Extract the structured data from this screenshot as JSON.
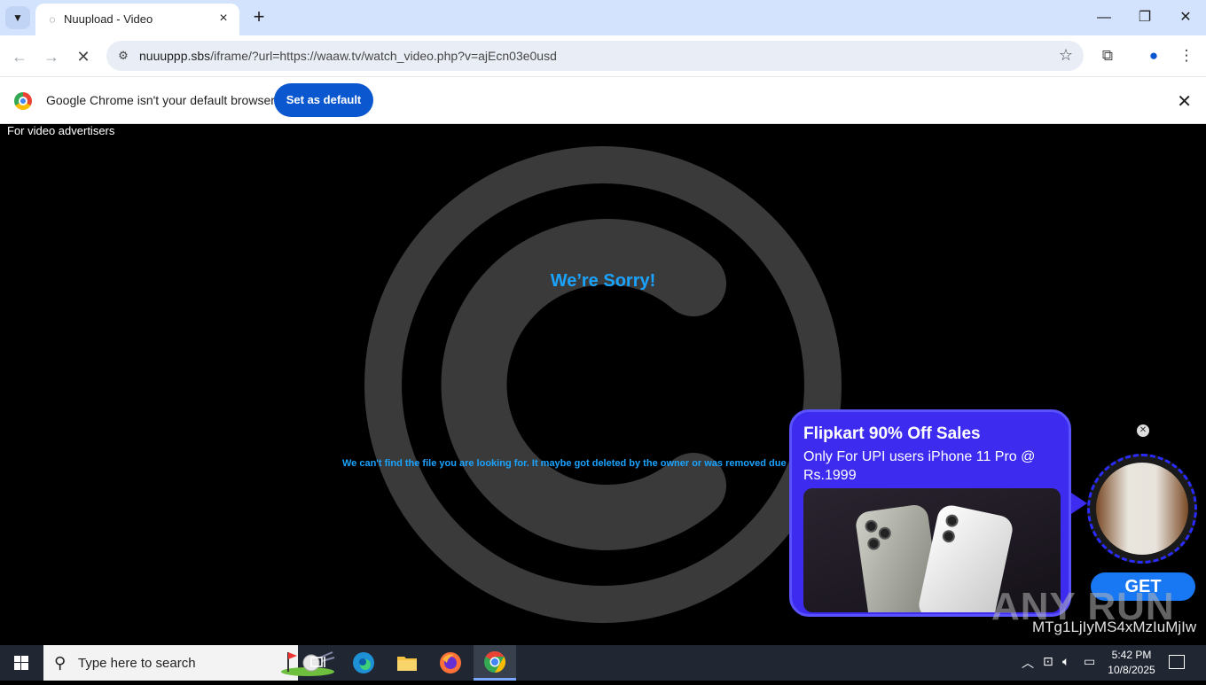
{
  "browser": {
    "tab_title": "Nuupload - Video",
    "url_host": "nuuuppp.sbs",
    "url_rest": "/iframe/?url=https://waaw.tv/watch_video.php?v=ajEcn03e0usd"
  },
  "infobar": {
    "message": "Google Chrome isn't your default browser",
    "button": "Set as default"
  },
  "page": {
    "advertisers_link": "For video advertisers",
    "heading": "We’re Sorry!",
    "message": "We can't find the file you are looking for. It maybe got deleted by the owner or was removed due a co"
  },
  "ad": {
    "headline": "Flipkart 90% Off Sales",
    "subtext": "Only For UPI users iPhone 11 Pro @ Rs.1999",
    "cta": "GET"
  },
  "watermark": {
    "brand": "ANY RUN",
    "id": "MTg1LjIyMS4xMzIuMjIw"
  },
  "taskbar": {
    "search_placeholder": "Type here to search",
    "time": "5:42 PM",
    "date": "10/8/2025"
  },
  "colors": {
    "accent_blue": "#0b57d0",
    "error_text": "#1aa3ff",
    "ad_bg": "#3d2cf0"
  }
}
